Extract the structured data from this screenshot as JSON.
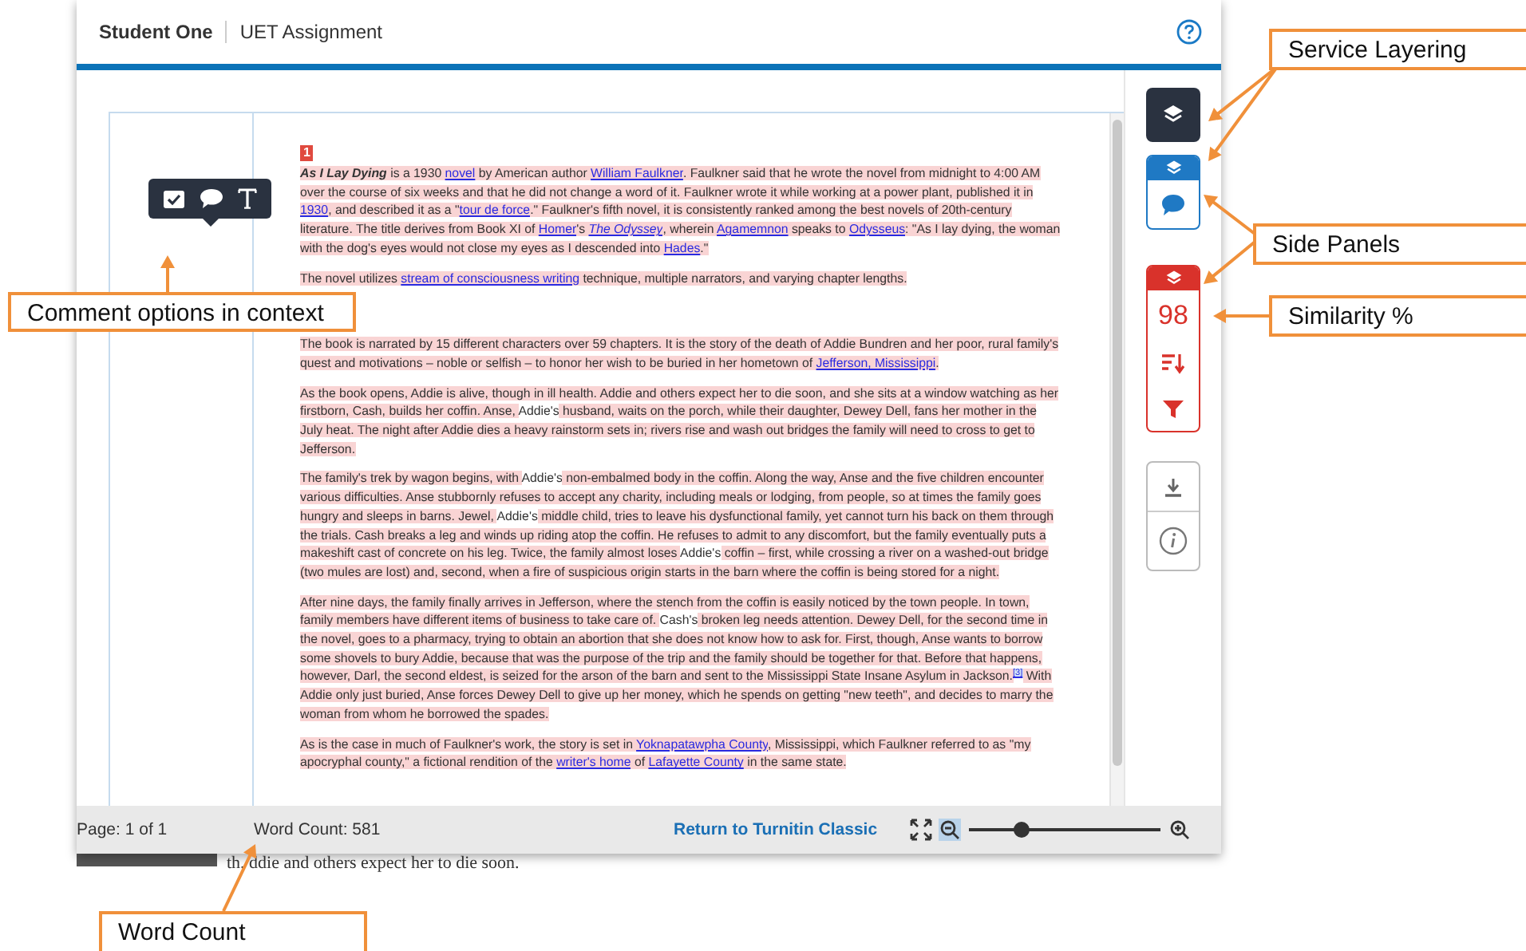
{
  "header": {
    "student": "Student One",
    "assignment": "UET Assignment"
  },
  "document": {
    "page_badge": "1",
    "paragraphs": [
      {
        "segments": [
          {
            "kind": "title",
            "text": "As I Lay Dying"
          },
          {
            "kind": "text",
            "text": " is a 1930 "
          },
          {
            "kind": "link",
            "text": "novel"
          },
          {
            "kind": "text",
            "text": " by American author "
          },
          {
            "kind": "link",
            "text": "William Faulkner"
          },
          {
            "kind": "text",
            "text": ". Faulkner said that he wrote the novel from midnight to 4:00 AM over the course of six weeks and that he did not change a word of it. Faulkner wrote it while working at a power plant, published it in "
          },
          {
            "kind": "link",
            "text": "1930"
          },
          {
            "kind": "text",
            "text": ", and described it as a \""
          },
          {
            "kind": "link",
            "text": "tour de force"
          },
          {
            "kind": "text",
            "text": ".\" Faulkner's fifth novel, it is consistently ranked among the best novels of 20th-century literature. The title derives from Book XI of "
          },
          {
            "kind": "link",
            "text": "Homer"
          },
          {
            "kind": "text",
            "text": "'s "
          },
          {
            "kind": "link_italic",
            "text": "The Odyssey"
          },
          {
            "kind": "text",
            "text": ", wherein "
          },
          {
            "kind": "link",
            "text": "Agamemnon"
          },
          {
            "kind": "text",
            "text": " speaks to "
          },
          {
            "kind": "link",
            "text": "Odysseus"
          },
          {
            "kind": "text",
            "text": ": \"As I lay dying, the woman with the dog's eyes would not close my eyes as I descended into "
          },
          {
            "kind": "link",
            "text": "Hades"
          },
          {
            "kind": "text",
            "text": ".\""
          }
        ]
      },
      {
        "segments": [
          {
            "kind": "text",
            "text": "The novel utilizes "
          },
          {
            "kind": "link",
            "text": "stream of consciousness writing"
          },
          {
            "kind": "text",
            "text": " technique, multiple narrators, and varying chapter lengths."
          }
        ]
      },
      {
        "segments": [
          {
            "kind": "text",
            "text": "The book is narrated by 15 different characters over 59 chapters. It is the story of the death of Addie Bundren and her poor, rural family's quest and motivations – noble or selfish – to honor her wish to be buried in her hometown of "
          },
          {
            "kind": "link",
            "text": "Jefferson, Mississippi"
          },
          {
            "kind": "text",
            "text": "."
          }
        ]
      },
      {
        "segments": [
          {
            "kind": "text",
            "text": "As the book opens, Addie is alive, though in ill health. Addie and others expect her to die soon, and she sits at a window watching as her firstborn, Cash, builds her coffin. Anse, "
          },
          {
            "kind": "plain",
            "text": "Addie's"
          },
          {
            "kind": "text",
            "text": " husband, waits on the porch, while their daughter, Dewey Dell, fans her mother in the July heat. The night after Addie dies a heavy rainstorm sets in; rivers rise and wash out bridges the family will need to cross to get to Jefferson."
          }
        ]
      },
      {
        "segments": [
          {
            "kind": "text",
            "text": "The family's trek by wagon begins, with "
          },
          {
            "kind": "plain",
            "text": "Addie's"
          },
          {
            "kind": "text",
            "text": " non-embalmed body in the coffin. Along the way, Anse and the five children encounter various difficulties. Anse stubbornly refuses to accept any charity, including meals or lodging, from people, so at times the family goes hungry and sleeps in barns. Jewel, "
          },
          {
            "kind": "plain",
            "text": "Addie's"
          },
          {
            "kind": "text",
            "text": " middle child, tries to leave his dysfunctional family, yet cannot turn his back on them through the trials. Cash breaks a leg and winds up riding atop the coffin. He refuses to admit to any discomfort, but the family eventually puts a makeshift cast of concrete on his leg. Twice, the family almost loses "
          },
          {
            "kind": "plain",
            "text": "Addie's"
          },
          {
            "kind": "text",
            "text": " coffin – first, while crossing a river on a washed-out bridge (two mules are lost) and, second, when a fire of suspicious origin starts in the barn where the coffin is being stored for a night."
          }
        ]
      },
      {
        "segments": [
          {
            "kind": "text",
            "text": "After nine days, the family finally arrives in Jefferson, where the stench from the coffin is easily noticed by the town people. In town, family members have different items of business to take care of. "
          },
          {
            "kind": "plain",
            "text": "Cash's"
          },
          {
            "kind": "text",
            "text": " broken leg needs attention. Dewey Dell, for the second time in the novel, goes to a pharmacy, trying to obtain an abortion that she does not know how to ask for. First, though, Anse wants to borrow some shovels to bury Addie, because that was the purpose of the trip and the family should be together for that. Before that happens, however, Darl, the second eldest, is seized for the arson of the barn and sent to the Mississippi State Insane Asylum in Jackson."
          },
          {
            "kind": "footnote",
            "text": "[3]"
          },
          {
            "kind": "text",
            "text": " With Addie only just buried, Anse forces Dewey Dell to give up her money, which he spends on getting \"new teeth\", and decides to marry the woman from whom he borrowed the spades."
          }
        ]
      },
      {
        "segments": [
          {
            "kind": "text",
            "text": "As is the case in much of Faulkner's work, the story is set in "
          },
          {
            "kind": "link",
            "text": "Yoknapatawpha County"
          },
          {
            "kind": "text",
            "text": ", Mississippi, which Faulkner referred to as \"my apocryphal county,\" a fictional rendition of the "
          },
          {
            "kind": "link",
            "text": "writer's home"
          },
          {
            "kind": "text",
            "text": " of "
          },
          {
            "kind": "link",
            "text": "Lafayette County"
          },
          {
            "kind": "text",
            "text": " in the same state."
          }
        ]
      }
    ]
  },
  "side_tools": {
    "similarity": "98"
  },
  "status_bar": {
    "page": "Page: 1 of 1",
    "word_count": "Word Count: 581",
    "return_link": "Return to Turnitin Classic",
    "zoom": {
      "level": 0.28
    }
  },
  "background_text": "th. ddie and others expect her to die soon.",
  "callouts": [
    {
      "text": "Service Layering"
    },
    {
      "text": "Side Panels"
    },
    {
      "text": "Similarity %"
    },
    {
      "text": "Comment options in context"
    },
    {
      "text": "Word Count"
    }
  ]
}
